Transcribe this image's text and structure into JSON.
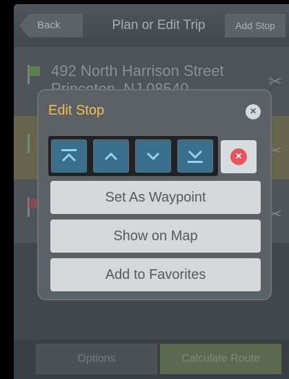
{
  "header": {
    "back_label": "Back",
    "title": "Plan or Edit Trip",
    "add_stop_label": "Add Stop"
  },
  "list": {
    "rows": [
      {
        "address": "492 North Harrison Street",
        "city": "Princeton, NJ 08540",
        "flag": "green"
      },
      {
        "address": "",
        "city": "",
        "flag": "yellow"
      },
      {
        "address": "",
        "city": "",
        "flag": "red"
      }
    ]
  },
  "footer": {
    "options_label": "Options",
    "calculate_label": "Calculate Route"
  },
  "dialog": {
    "title": "Edit Stop",
    "title_color": "#f2c04e",
    "toolbar_icons": [
      "move-to-top-icon",
      "move-up-icon",
      "move-down-icon",
      "move-to-bottom-icon"
    ],
    "delete_icon": "delete-icon",
    "buttons": {
      "waypoint": "Set As Waypoint",
      "map": "Show on Map",
      "favorites": "Add to Favorites"
    }
  }
}
